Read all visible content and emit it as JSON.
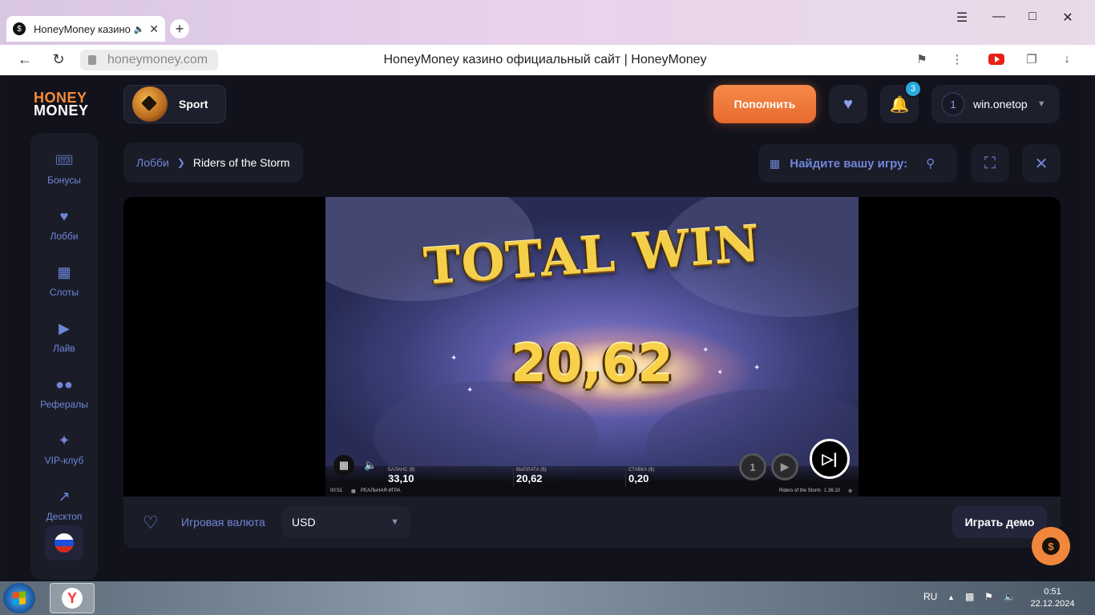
{
  "browser": {
    "tab_title": "HoneyMoney казино официальный сайт",
    "url": "honeymoney.com",
    "page_title": "HoneyMoney казино официальный сайт | HoneyMoney"
  },
  "header": {
    "logo_line1": "HONEY",
    "logo_line2": "MONEY",
    "sport_label": "Sport",
    "deposit_label": "Пополнить",
    "notifications_count": "3",
    "user_level": "1",
    "username": "win.onetop"
  },
  "sidebar": {
    "items": [
      {
        "label": "Бонусы",
        "icon": "ticket-icon"
      },
      {
        "label": "Лобби",
        "icon": "heart-icon"
      },
      {
        "label": "Слоты",
        "icon": "grid-icon"
      },
      {
        "label": "Лайв",
        "icon": "video-camera-icon"
      },
      {
        "label": "Рефералы",
        "icon": "users-icon"
      },
      {
        "label": "VIP-клуб",
        "icon": "sparkles-icon"
      },
      {
        "label": "Десктоп",
        "icon": "external-link-icon"
      }
    ],
    "language_flag": "ru-flag-icon"
  },
  "breadcrumb": {
    "lobby": "Лобби",
    "current": "Riders of the Storm"
  },
  "search": {
    "placeholder": "Найдите вашу игру:"
  },
  "game": {
    "headline": "TOTAL WIN",
    "win_amount": "20,62",
    "balance_label": "БАЛАНС ($)",
    "balance_value": "33,10",
    "payout_label": "ВЫПЛАТА ($)",
    "payout_value": "20,62",
    "bet_label": "СТАВКА ($)",
    "bet_value": "0,20",
    "time": "00:51",
    "mode": "РЕАЛЬНАЯ ИГРА",
    "game_name": "Riders of the Storm",
    "version": "1.36.10",
    "coin_value": "1"
  },
  "controls": {
    "currency_label": "Игровая валюта",
    "currency_value": "USD",
    "demo_label": "Играть демо"
  },
  "taskbar": {
    "lang": "RU",
    "time": "0:51",
    "date": "22.12.2024"
  },
  "colors": {
    "accent": "#f0873c",
    "sidebar_text": "#6f86d8",
    "background": "#11121b"
  }
}
